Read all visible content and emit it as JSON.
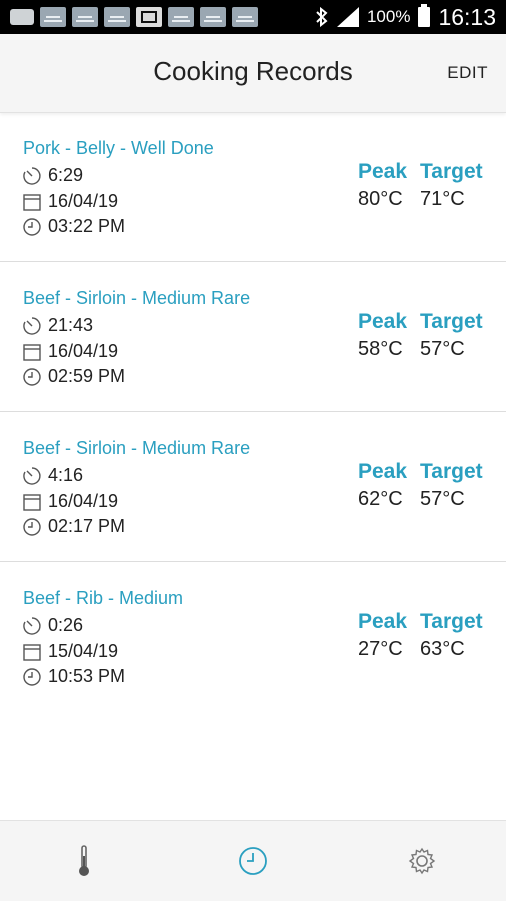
{
  "status_bar": {
    "battery": "100%",
    "time": "16:13"
  },
  "app_bar": {
    "title": "Cooking Records",
    "edit_label": "EDIT"
  },
  "records": [
    {
      "name": "Pork - Belly - Well Done",
      "duration": "6:29",
      "date": "16/04/19",
      "time": "03:22 PM",
      "peak_label": "Peak",
      "target_label": "Target",
      "peak": "80°C",
      "target": "71°C"
    },
    {
      "name": "Beef - Sirloin - Medium Rare",
      "duration": "21:43",
      "date": "16/04/19",
      "time": "02:59 PM",
      "peak_label": "Peak",
      "target_label": "Target",
      "peak": "58°C",
      "target": "57°C"
    },
    {
      "name": "Beef - Sirloin - Medium Rare",
      "duration": "4:16",
      "date": "16/04/19",
      "time": "02:17 PM",
      "peak_label": "Peak",
      "target_label": "Target",
      "peak": "62°C",
      "target": "57°C"
    },
    {
      "name": "Beef - Rib - Medium",
      "duration": "0:26",
      "date": "15/04/19",
      "time": "10:53 PM",
      "peak_label": "Peak",
      "target_label": "Target",
      "peak": "27°C",
      "target": "63°C"
    }
  ],
  "bottom_nav": {
    "tabs": [
      {
        "icon": "thermometer-icon"
      },
      {
        "icon": "clock-icon",
        "active": true
      },
      {
        "icon": "gear-icon"
      }
    ]
  },
  "colors": {
    "accent": "#2a9fc0",
    "text": "#222222",
    "bar": "#f5f5f5"
  }
}
